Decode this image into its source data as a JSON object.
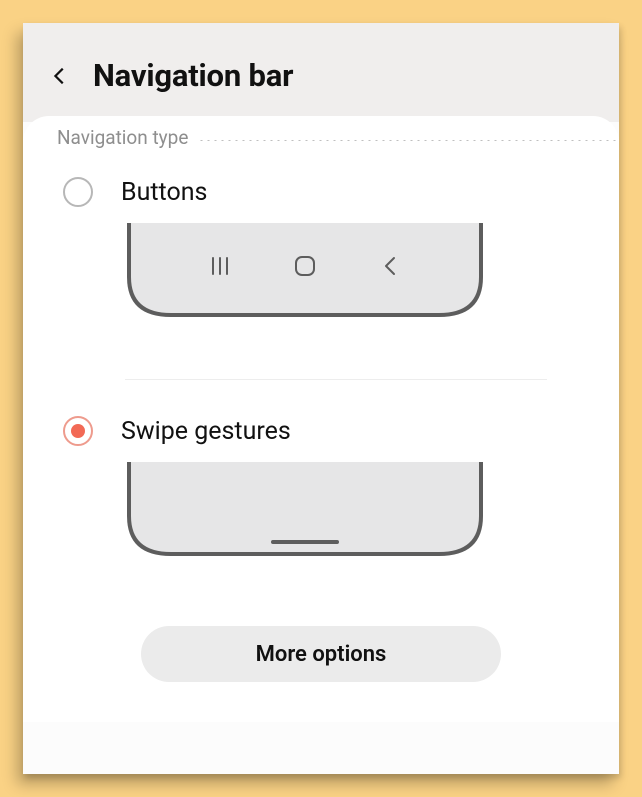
{
  "header": {
    "title": "Navigation bar"
  },
  "section": {
    "title": "Navigation type"
  },
  "options": [
    {
      "id": "buttons",
      "label": "Buttons",
      "selected": false
    },
    {
      "id": "swipe",
      "label": "Swipe gestures",
      "selected": true
    }
  ],
  "more_options_label": "More options"
}
